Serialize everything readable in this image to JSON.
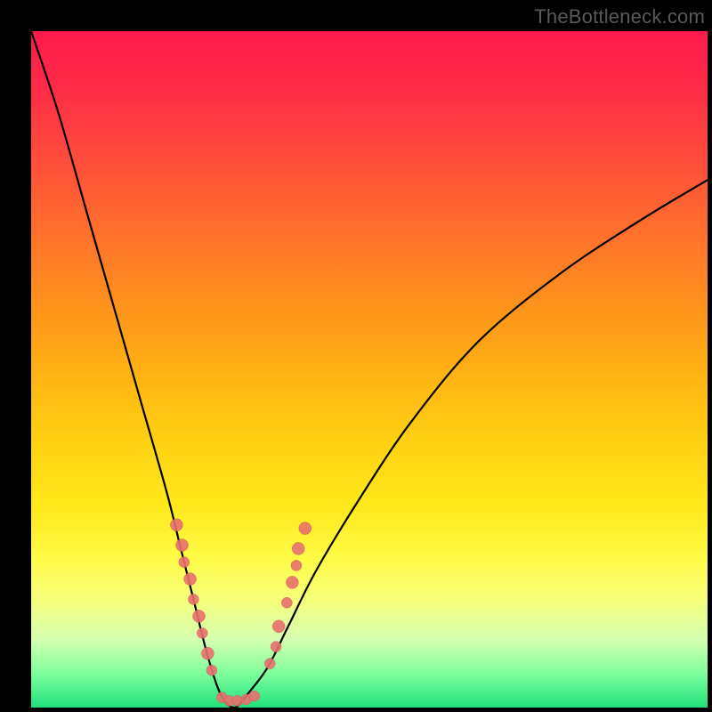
{
  "watermark": "TheBottleneck.com",
  "colors": {
    "curve": "#000000",
    "marker_fill": "#e9716f",
    "marker_stroke": "#c95a58"
  },
  "chart_data": {
    "type": "line",
    "title": "",
    "xlabel": "",
    "ylabel": "",
    "xlim": [
      0,
      100
    ],
    "ylim": [
      0,
      100
    ],
    "notes": "V-shaped bottleneck curve rendered over a vertical heat gradient (red → green). Y-axis is inverted visually (low values near bottom = green/good). Curve minimum ≈ x 28–32 touching y≈0. Pink circular markers cluster along both arms of the V roughly between y 5 and y 28.",
    "series": [
      {
        "name": "bottleneck-curve-left",
        "x": [
          0,
          4,
          8,
          12,
          16,
          20,
          22,
          24,
          26,
          28,
          30
        ],
        "y": [
          100,
          88,
          74,
          60,
          46,
          32,
          24,
          16,
          8,
          2,
          0
        ]
      },
      {
        "name": "bottleneck-curve-right",
        "x": [
          30,
          32,
          35,
          38,
          42,
          48,
          56,
          66,
          78,
          90,
          100
        ],
        "y": [
          0,
          2,
          6,
          12,
          20,
          30,
          42,
          54,
          64,
          72,
          78
        ]
      }
    ],
    "markers": [
      {
        "x": 21.5,
        "y": 27.0,
        "r": 7
      },
      {
        "x": 22.3,
        "y": 24.0,
        "r": 7
      },
      {
        "x": 22.6,
        "y": 21.5,
        "r": 6
      },
      {
        "x": 23.5,
        "y": 19.0,
        "r": 7
      },
      {
        "x": 24.0,
        "y": 16.0,
        "r": 6
      },
      {
        "x": 24.8,
        "y": 13.5,
        "r": 7
      },
      {
        "x": 25.3,
        "y": 11.0,
        "r": 6
      },
      {
        "x": 26.1,
        "y": 8.0,
        "r": 7
      },
      {
        "x": 26.7,
        "y": 5.5,
        "r": 6
      },
      {
        "x": 28.2,
        "y": 1.5,
        "r": 6
      },
      {
        "x": 29.3,
        "y": 1.0,
        "r": 6
      },
      {
        "x": 30.5,
        "y": 1.0,
        "r": 6
      },
      {
        "x": 31.8,
        "y": 1.2,
        "r": 6
      },
      {
        "x": 33.0,
        "y": 1.7,
        "r": 6
      },
      {
        "x": 35.3,
        "y": 6.5,
        "r": 6
      },
      {
        "x": 36.2,
        "y": 9.0,
        "r": 6
      },
      {
        "x": 36.6,
        "y": 12.0,
        "r": 7
      },
      {
        "x": 37.8,
        "y": 15.5,
        "r": 6
      },
      {
        "x": 38.6,
        "y": 18.5,
        "r": 7
      },
      {
        "x": 39.2,
        "y": 21.0,
        "r": 6
      },
      {
        "x": 39.5,
        "y": 23.5,
        "r": 7
      },
      {
        "x": 40.5,
        "y": 26.5,
        "r": 7
      }
    ]
  }
}
